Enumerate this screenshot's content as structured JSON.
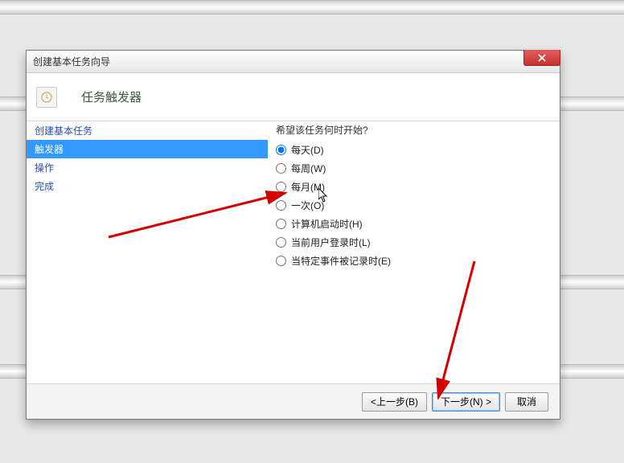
{
  "window": {
    "title": "创建基本任务向导"
  },
  "header": {
    "title": "任务触发器"
  },
  "sidebar": {
    "items": [
      {
        "label": "创建基本任务"
      },
      {
        "label": "触发器"
      },
      {
        "label": "操作"
      },
      {
        "label": "完成"
      }
    ],
    "selectedIndex": 1
  },
  "main": {
    "question": "希望该任务何时开始?",
    "options": [
      {
        "label": "每天(D)",
        "value": "daily",
        "checked": true
      },
      {
        "label": "每周(W)",
        "value": "weekly",
        "checked": false
      },
      {
        "label": "每月(M)",
        "value": "monthly",
        "checked": false
      },
      {
        "label": "一次(O)",
        "value": "once",
        "checked": false
      },
      {
        "label": "计算机启动时(H)",
        "value": "startup",
        "checked": false
      },
      {
        "label": "当前用户登录时(L)",
        "value": "logon",
        "checked": false
      },
      {
        "label": "当特定事件被记录时(E)",
        "value": "event",
        "checked": false
      }
    ]
  },
  "footer": {
    "back": "<上一步(B)",
    "next": "下一步(N) >",
    "cancel": "取消"
  }
}
